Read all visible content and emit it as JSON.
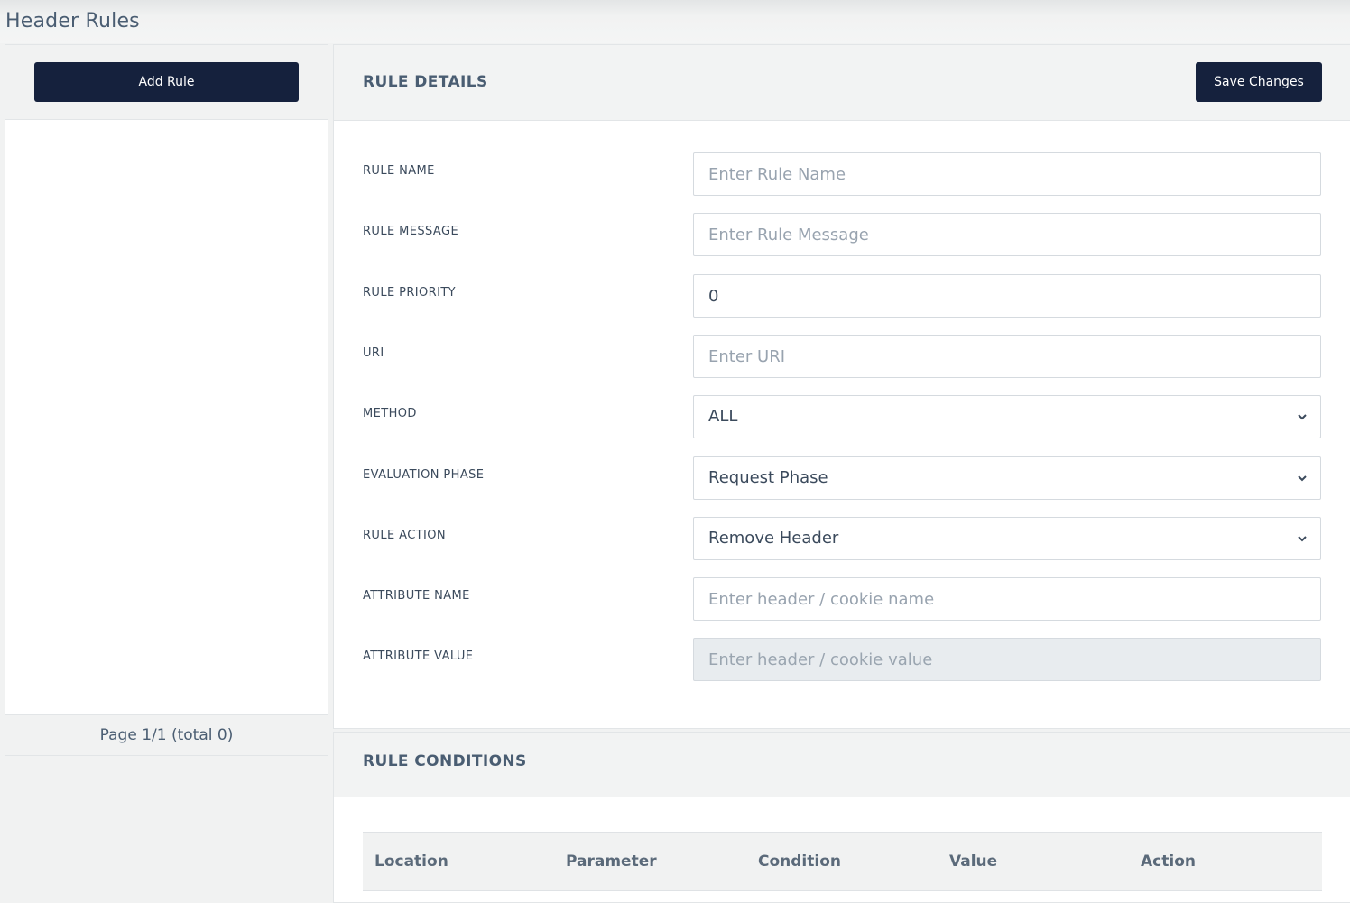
{
  "page": {
    "title": "Header Rules"
  },
  "sidebar": {
    "add_rule_label": "Add Rule",
    "pagination": "Page 1/1 (total 0)"
  },
  "details": {
    "title": "RULE DETAILS",
    "save_label": "Save Changes",
    "fields": {
      "rule_name": {
        "label": "RULE NAME",
        "value": "",
        "placeholder": "Enter Rule Name"
      },
      "rule_message": {
        "label": "RULE MESSAGE",
        "value": "",
        "placeholder": "Enter Rule Message"
      },
      "rule_priority": {
        "label": "RULE PRIORITY",
        "value": "0",
        "placeholder": ""
      },
      "uri": {
        "label": "URI",
        "value": "",
        "placeholder": "Enter URI"
      },
      "method": {
        "label": "METHOD",
        "selected": "ALL"
      },
      "evaluation_phase": {
        "label": "EVALUATION PHASE",
        "selected": "Request Phase"
      },
      "rule_action": {
        "label": "RULE ACTION",
        "selected": "Remove Header"
      },
      "attribute_name": {
        "label": "ATTRIBUTE NAME",
        "value": "",
        "placeholder": "Enter header / cookie name"
      },
      "attribute_value": {
        "label": "ATTRIBUTE VALUE",
        "value": "",
        "placeholder": "Enter header / cookie value",
        "disabled": true
      }
    }
  },
  "conditions": {
    "title": "RULE CONDITIONS",
    "columns": [
      "Location",
      "Parameter",
      "Condition",
      "Value",
      "Action"
    ]
  },
  "colors": {
    "primary_button": "#15213d",
    "background": "#f1f2f2",
    "text": "#3b4a5c",
    "disabled_input": "#e8ecef"
  },
  "icons": {
    "dropdown": "chevron-down-icon"
  }
}
